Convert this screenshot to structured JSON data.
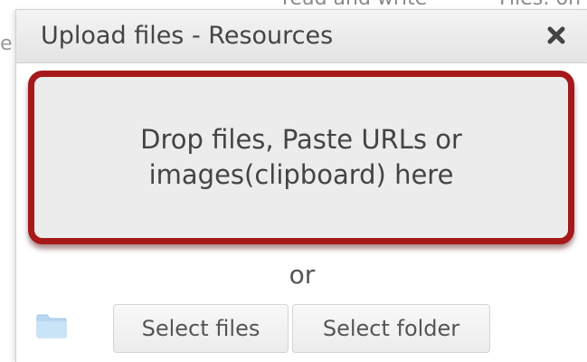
{
  "background": {
    "fragment_one": "read and write",
    "fragment_two": "Files: on",
    "fragment_left": "e"
  },
  "dialog": {
    "title": "Upload files - Resources",
    "close_icon": "close-icon",
    "dropzone_text": "Drop files, Paste URLs or images(clipboard) here",
    "or_text": "or",
    "folder_icon": "folder-icon",
    "select_files_label": "Select files",
    "select_folder_label": "Select folder"
  },
  "colors": {
    "highlight_border": "#a5191a",
    "dropzone_bg": "#ececec",
    "folder_icon": "#b7d8f2"
  }
}
